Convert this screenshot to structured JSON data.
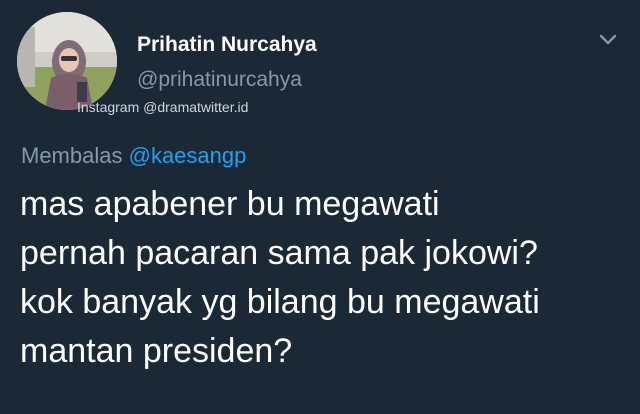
{
  "header": {
    "display_name": "Prihatin Nurcahya",
    "handle": "@prihatinurcahya",
    "watermark": "Instagram @dramatwitter.id",
    "avatar_icon": "profile-photo",
    "menu_icon": "chevron-down-icon"
  },
  "reply": {
    "prefix": "Membalas",
    "mention": "@kaesangp"
  },
  "tweet": {
    "lines": [
      "mas apabener bu megawati",
      "pernah pacaran sama pak jokowi?",
      "kok banyak yg bilang bu megawati",
      "mantan presiden?"
    ]
  },
  "colors": {
    "background": "#1b2937",
    "text": "#ffffff",
    "secondary": "#8899a6",
    "link": "#1da1f2"
  }
}
